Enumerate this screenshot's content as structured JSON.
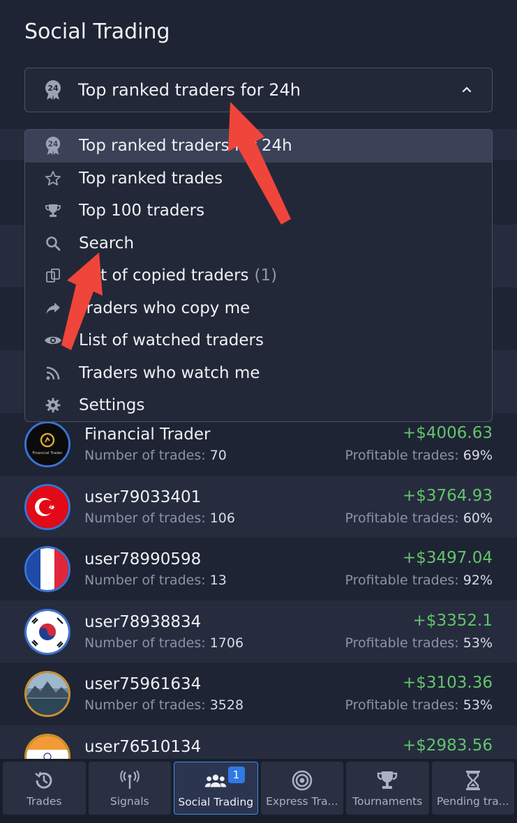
{
  "header": {
    "title": "Social Trading"
  },
  "selector": {
    "label": "Top ranked traders for 24h",
    "icon": "award-24-icon"
  },
  "dropdown": {
    "items": [
      {
        "label": "Top ranked traders for 24h",
        "icon": "award-24-icon",
        "count": ""
      },
      {
        "label": "Top ranked trades",
        "icon": "star-icon",
        "count": ""
      },
      {
        "label": "Top 100 traders",
        "icon": "trophy-icon",
        "count": ""
      },
      {
        "label": "Search",
        "icon": "search-icon",
        "count": ""
      },
      {
        "label": "List of copied traders",
        "icon": "copy-icon",
        "count": "(1)"
      },
      {
        "label": "Traders who copy me",
        "icon": "share-icon",
        "count": ""
      },
      {
        "label": "List of watched traders",
        "icon": "eye-icon",
        "count": ""
      },
      {
        "label": "Traders who watch me",
        "icon": "rss-icon",
        "count": ""
      },
      {
        "label": "Settings",
        "icon": "gear-icon",
        "count": ""
      }
    ]
  },
  "traders": {
    "trades_label": "Number of trades:",
    "profitable_label": "Profitable trades:",
    "rows": [
      {
        "name": "Financial Trader",
        "trades": "70",
        "profit": "+$4006.63",
        "pct": "69%",
        "avatar": "financial-trader-logo"
      },
      {
        "name": "user79033401",
        "trades": "106",
        "profit": "+$3764.93",
        "pct": "60%",
        "avatar": "turkey-flag"
      },
      {
        "name": "user78990598",
        "trades": "13",
        "profit": "+$3497.04",
        "pct": "92%",
        "avatar": "france-flag"
      },
      {
        "name": "user78938834",
        "trades": "1706",
        "profit": "+$3352.1",
        "pct": "53%",
        "avatar": "south-korea-flag"
      },
      {
        "name": "user75961634",
        "trades": "3528",
        "profit": "+$3103.36",
        "pct": "53%",
        "avatar": "landscape-photo"
      },
      {
        "name": "user76510134",
        "trades": "",
        "profit": "+$2983.56",
        "pct": "",
        "avatar": "india-flag"
      }
    ],
    "avatar_logo_text": "Financial Trader"
  },
  "bottom_nav": {
    "items": [
      {
        "label": "Trades",
        "icon": "history-icon"
      },
      {
        "label": "Signals",
        "icon": "antenna-icon"
      },
      {
        "label": "Social Trading",
        "icon": "users-icon",
        "badge": "1"
      },
      {
        "label": "Express Tra...",
        "icon": "target-icon"
      },
      {
        "label": "Tournaments",
        "icon": "trophy-icon"
      },
      {
        "label": "Pending tra...",
        "icon": "hourglass-icon"
      }
    ]
  },
  "colors": {
    "background": "#1f2434",
    "profit_green": "#63c46b",
    "accent_blue": "#3d8bf0",
    "annotation_arrow": "#f0453a"
  }
}
